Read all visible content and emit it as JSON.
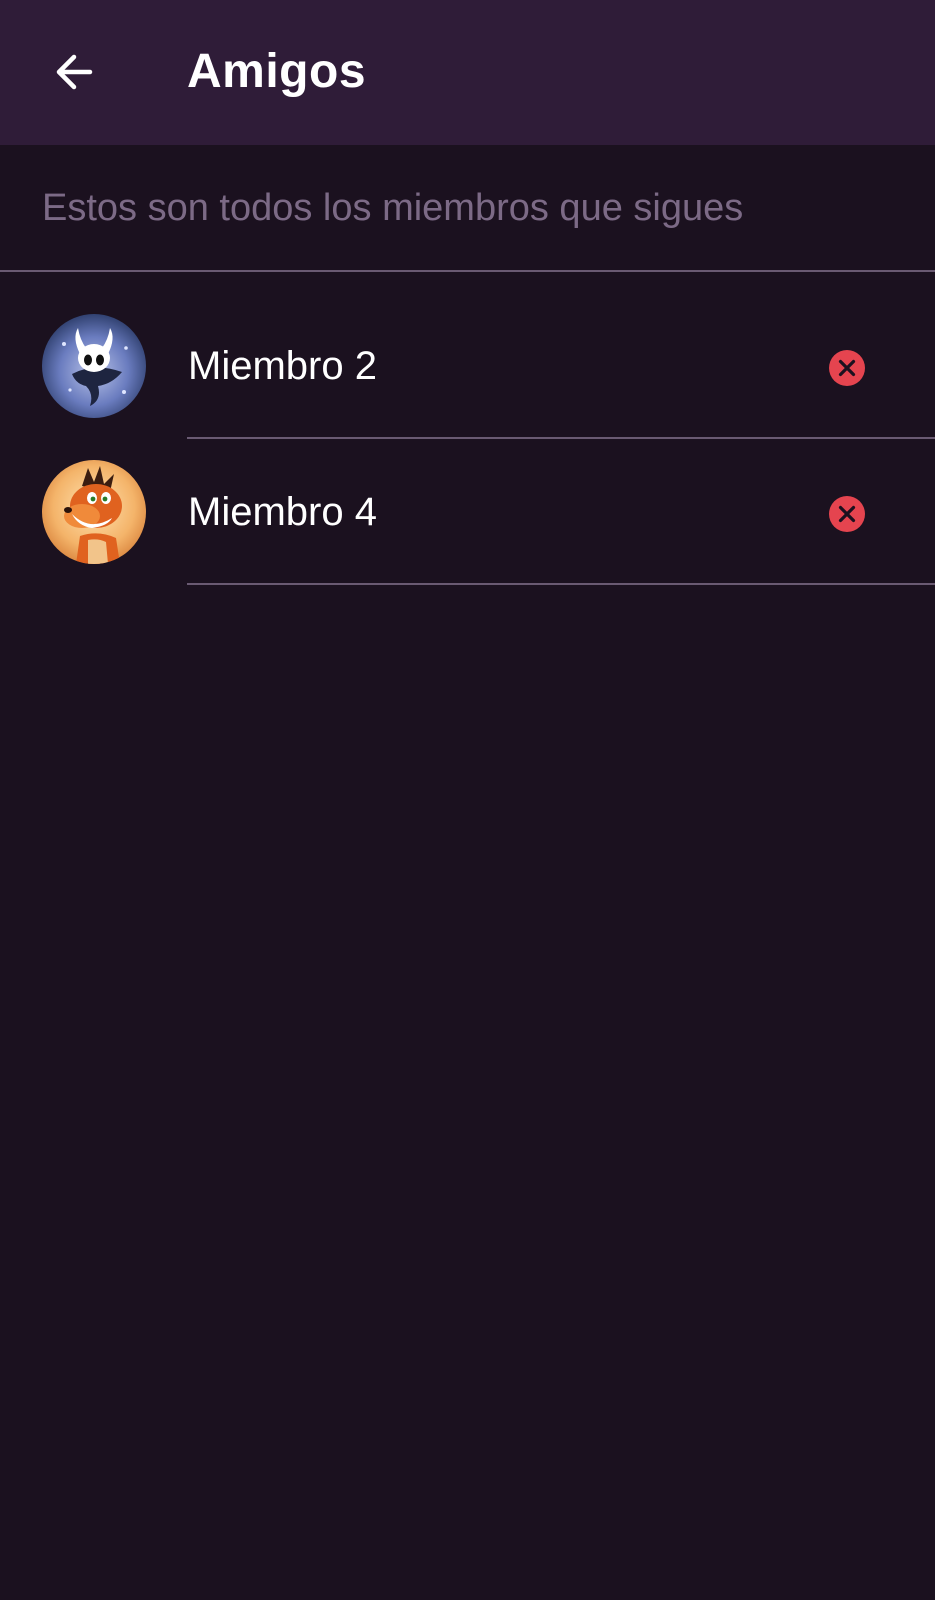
{
  "app_bar": {
    "title": "Amigos",
    "back_icon": "arrow-left-icon",
    "background_color": "#2f1c38"
  },
  "subtitle": "Estos son todos los miembros que sigues",
  "friends": [
    {
      "name": "Miembro 2",
      "avatar": "hollow-knight-avatar",
      "remove_icon": "remove-circle-icon"
    },
    {
      "name": "Miembro 4",
      "avatar": "crash-bandicoot-avatar",
      "remove_icon": "remove-circle-icon"
    }
  ],
  "colors": {
    "background": "#1b111f",
    "remove_accent": "#e5444f",
    "subtitle_text": "#7c6a86",
    "divider": "#6a5a72"
  }
}
